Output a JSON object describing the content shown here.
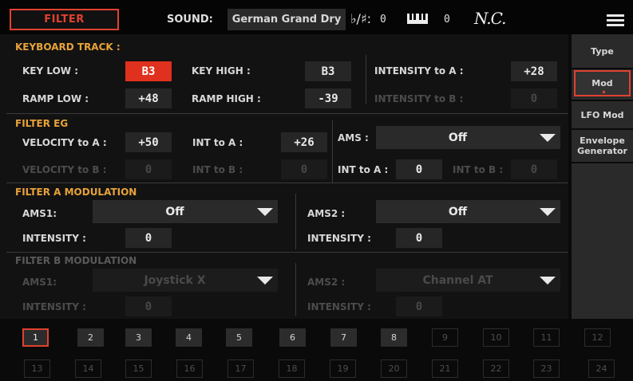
{
  "header": {
    "mode_tab": "FILTER",
    "sound_label": "SOUND:",
    "sound_name": "German Grand Dry",
    "flat_sharp_symbol": "♭/♯:",
    "flat_sharp_value": "0",
    "piano_icon": "keyboard-icon",
    "piano_value": "0",
    "chord": "N.C.",
    "menu_icon": "hamburger-menu-icon"
  },
  "keyboard_track": {
    "title": "KEYBOARD TRACK :",
    "key_low_label": "KEY LOW :",
    "key_low_value": "B3",
    "key_high_label": "KEY HIGH :",
    "key_high_value": "B3",
    "intensity_a_label": "INTENSITY to A :",
    "intensity_a_value": "+28",
    "ramp_low_label": "RAMP LOW :",
    "ramp_low_value": "+48",
    "ramp_high_label": "RAMP HIGH :",
    "ramp_high_value": "-39",
    "intensity_b_label": "INTENSITY to B :",
    "intensity_b_value": "0"
  },
  "filter_eg": {
    "title": "FILTER EG",
    "vel_a_label": "VELOCITY to A :",
    "vel_a_value": "+50",
    "int_a_label": "INT to A :",
    "int_a_value": "+26",
    "ams_label": "AMS :",
    "ams_value": "Off",
    "vel_b_label": "VELOCITY to B :",
    "vel_b_value": "0",
    "int_b_label": "INT to B :",
    "int_b_value": "0",
    "ams_int_a_label": "INT to A :",
    "ams_int_a_value": "0",
    "ams_int_b_label": "INT to B :",
    "ams_int_b_value": "0"
  },
  "filter_a_mod": {
    "title": "FILTER A MODULATION",
    "ams1_label": "AMS1:",
    "ams1_value": "Off",
    "ams2_label": "AMS2 :",
    "ams2_value": "Off",
    "intensity1_label": "INTENSITY :",
    "intensity1_value": "0",
    "intensity2_label": "INTENSITY :",
    "intensity2_value": "0"
  },
  "filter_b_mod": {
    "title": "FILTER B MODULATION",
    "ams1_label": "AMS1:",
    "ams1_value": "Joystick X",
    "ams2_label": "AMS2 :",
    "ams2_value": "Channel AT",
    "intensity1_label": "INTENSITY :",
    "intensity1_value": "0",
    "intensity2_label": "INTENSITY :",
    "intensity2_value": "0"
  },
  "side_tabs": {
    "type": "Type",
    "mod": "Mod",
    "lfo_mod": "LFO Mod",
    "envelope": "Envelope Generator"
  },
  "numbers": {
    "n1": "1",
    "n2": "2",
    "n3": "3",
    "n4": "4",
    "n5": "5",
    "n6": "6",
    "n7": "7",
    "n8": "8",
    "n9": "9",
    "n10": "10",
    "n11": "11",
    "n12": "12",
    "n13": "13",
    "n14": "14",
    "n15": "15",
    "n16": "16",
    "n17": "17",
    "n18": "18",
    "n19": "19",
    "n20": "20",
    "n21": "21",
    "n22": "22",
    "n23": "23",
    "n24": "24"
  },
  "colors": {
    "accent": "#e0422f",
    "section_title": "#e8a23a"
  }
}
